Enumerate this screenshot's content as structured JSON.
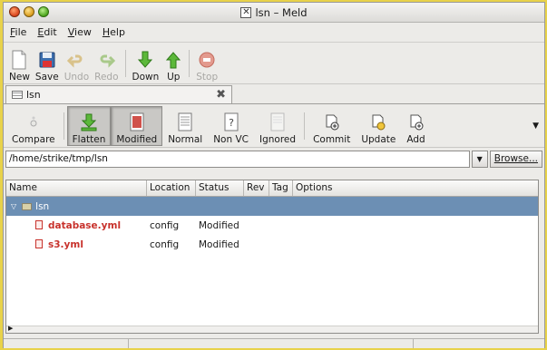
{
  "window": {
    "title": "lsn – Meld"
  },
  "menu": {
    "items": [
      {
        "key": "file",
        "accel": "F",
        "rest": "ile"
      },
      {
        "key": "edit",
        "accel": "E",
        "rest": "dit"
      },
      {
        "key": "view",
        "accel": "V",
        "rest": "iew"
      },
      {
        "key": "help",
        "accel": "H",
        "rest": "elp"
      }
    ]
  },
  "toolbar": {
    "new_label": "New",
    "save_label": "Save",
    "undo_label": "Undo",
    "redo_label": "Redo",
    "down_label": "Down",
    "up_label": "Up",
    "stop_label": "Stop"
  },
  "tab": {
    "label": "lsn"
  },
  "filterbar": {
    "compare_label": "Compare",
    "flatten_label": "Flatten",
    "modified_label": "Modified",
    "normal_label": "Normal",
    "nonvc_label": "Non VC",
    "ignored_label": "Ignored",
    "commit_label": "Commit",
    "update_label": "Update",
    "add_label": "Add"
  },
  "path": {
    "value": "/home/strike/tmp/lsn",
    "browse_label": "Browse..."
  },
  "table": {
    "columns": [
      "Name",
      "Location",
      "Status",
      "Rev",
      "Tag",
      "Options"
    ],
    "root": {
      "name": "lsn"
    },
    "rows": [
      {
        "name": "database.yml",
        "location": "config",
        "status": "Modified"
      },
      {
        "name": "s3.yml",
        "location": "config",
        "status": "Modified"
      }
    ]
  },
  "colors": {
    "selection": "#6c8fb4",
    "modified_text": "#c8322c"
  }
}
